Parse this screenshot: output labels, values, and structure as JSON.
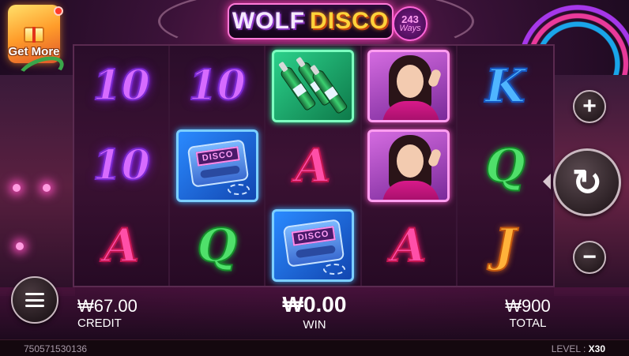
{
  "title": {
    "logo_word_1": "WOLF",
    "logo_word_2": "DISCO",
    "ways_number": "243",
    "ways_label": "Ways"
  },
  "promo": {
    "get_more_label": "Get More"
  },
  "reels": [
    {
      "symbols": [
        "10",
        "10",
        "A"
      ]
    },
    {
      "symbols": [
        "10",
        "disco-pager",
        "Q"
      ]
    },
    {
      "symbols": [
        "green-bottles",
        "A",
        "disco-pager"
      ]
    },
    {
      "symbols": [
        "disco-lady",
        "disco-lady",
        "A"
      ]
    },
    {
      "symbols": [
        "K",
        "Q",
        "J"
      ]
    }
  ],
  "symbol_text": {
    "pager_screen": "DISCO"
  },
  "controls": {
    "plus_icon": "+",
    "minus_icon": "−",
    "spin_icon": "↻"
  },
  "stats": {
    "credit_value": "₩67.00",
    "credit_label": "CREDIT",
    "win_value": "₩0.00",
    "win_label": "WIN",
    "total_value": "₩900",
    "total_label": "TOTAL"
  },
  "footer": {
    "session_id": "750571530136",
    "level_label": "LEVEL : ",
    "level_value": "X30"
  },
  "colors": {
    "sym_10": "#d66bff",
    "sym_A": "#ff4fa8",
    "sym_Q": "#4fe06a",
    "sym_K": "#4fb5ff",
    "sym_J": "#ffb23a"
  }
}
